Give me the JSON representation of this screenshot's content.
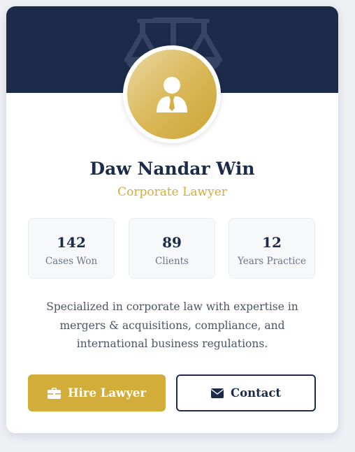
{
  "profile": {
    "name": "Daw Nandar Win",
    "title": "Corporate Lawyer",
    "bio": "Specialized in corporate law with expertise in mergers & acquisitions, compliance, and international business regulations."
  },
  "stats": [
    {
      "value": "142",
      "label": "Cases Won"
    },
    {
      "value": "89",
      "label": "Clients"
    },
    {
      "value": "12",
      "label": "Years Practice"
    }
  ],
  "actions": {
    "hire_label": "Hire Lawyer",
    "contact_label": "Contact"
  },
  "icons": {
    "banner": "scales-of-justice-icon",
    "avatar": "user-tie-icon",
    "hire": "briefcase-icon",
    "contact": "envelope-icon"
  },
  "colors": {
    "navy": "#1c2b4a",
    "gold": "#d2ad3a",
    "text_muted": "#6b7489",
    "stat_bg": "#f6f8fa"
  }
}
